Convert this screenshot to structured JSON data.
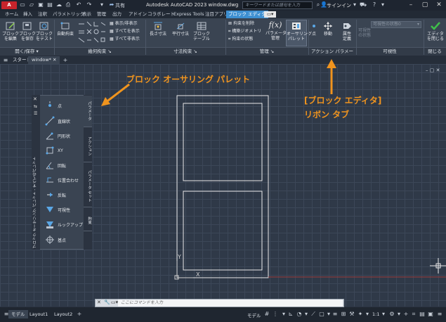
{
  "title_bar": {
    "app_logo": "A CAD",
    "share_label": "共有",
    "app_title": "Autodesk AutoCAD 2023    window.dwg",
    "search_placeholder": "キーワードまたは語句を入力",
    "signin_label": "サインイン"
  },
  "ribbon_tabs": [
    {
      "label": "ホーム"
    },
    {
      "label": "挿入"
    },
    {
      "label": "注釈"
    },
    {
      "label": "パラメトリック"
    },
    {
      "label": "表示"
    },
    {
      "label": "管理"
    },
    {
      "label": "出力"
    },
    {
      "label": "アドイン"
    },
    {
      "label": "コラボレート"
    },
    {
      "label": "Express Tools"
    },
    {
      "label": "注目アプリ"
    },
    {
      "label": "ブロック エディタ"
    }
  ],
  "ribbon": {
    "open_save": {
      "label": "開く/保存",
      "edit_block": "ブロック\nを編集",
      "save_block": "ブロック\nを保存",
      "test_block": "ブロック\nをテスト"
    },
    "geometric": {
      "label": "幾何拘束",
      "auto_constrain": "自動拘束",
      "show_hide": "表示/非表示",
      "show_all": "すべてを表示",
      "hide_all": "すべて非表示"
    },
    "dimensional": {
      "label": "寸法拘束",
      "linear": "長さ寸法",
      "aligned": "平行寸法",
      "block_table": "ブロック\nテーブル"
    },
    "manage": {
      "label": "管理",
      "delete_constraint": "拘束を削除",
      "construction": "構築ジオメトリ",
      "constraint_state": "拘束の状態",
      "param_manager": "パラメータ\n管理",
      "authoring_palette": "オーサリング\nパレット"
    },
    "action_params": {
      "label": "アクション パラメータ",
      "point": "点",
      "move": "移動",
      "attribute": "属性\n定義"
    },
    "visibility": {
      "label": "可視性",
      "state": "可視性の状態",
      "visibility_state_value": "可視性の状態0"
    },
    "close": {
      "label": "閉じる",
      "close_editor": "エディタ\nを閉じる"
    }
  },
  "file_tabs": [
    {
      "label": "スタート"
    },
    {
      "label": "window*"
    }
  ],
  "palette": {
    "title": "ブロック オーサリング パレット - すべてのパレット",
    "tabs": [
      "パラメータ",
      "アクション",
      "パラメータ セット",
      "拘束"
    ],
    "items": [
      {
        "label": "点"
      },
      {
        "label": "直線状"
      },
      {
        "label": "円形状"
      },
      {
        "label": "XY"
      },
      {
        "label": "回転"
      },
      {
        "label": "位置合わせ"
      },
      {
        "label": "反転"
      },
      {
        "label": "可視性"
      },
      {
        "label": "ルックアップ"
      },
      {
        "label": "基点"
      }
    ]
  },
  "annotations": {
    "palette_note": "ブロック オーサリング パレット",
    "ribbon_note_line1": "[ブロック エディタ]",
    "ribbon_note_line2": "リボン タブ",
    "accent_color": "#f0941e"
  },
  "canvas": {
    "ucs_y": "Y",
    "ucs_x": "X"
  },
  "command_line": {
    "placeholder": "ここにコマンドを入力"
  },
  "status_bar": {
    "tabs": [
      {
        "label": "モデル"
      },
      {
        "label": "Layout1"
      },
      {
        "label": "Layout2"
      }
    ],
    "model_label": "モデル",
    "scale": "1:1"
  }
}
